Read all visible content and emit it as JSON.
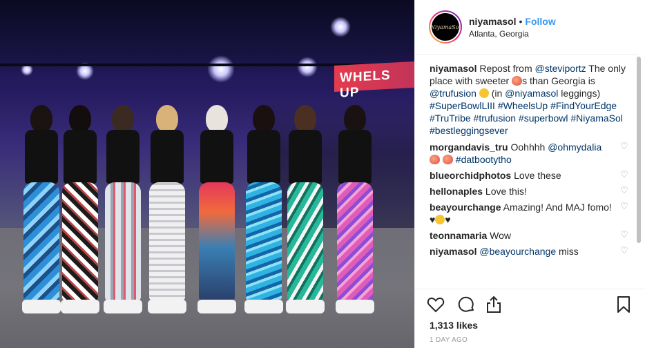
{
  "post": {
    "photo_sign_text": "WHELS UP",
    "header": {
      "avatar_text": "NiyamaSol",
      "username": "niyamasol",
      "separator": "•",
      "follow_label": "Follow",
      "location": "Atlanta, Georgia"
    },
    "caption": {
      "username": "niyamasol",
      "segments": {
        "t1": " Repost from ",
        "m1": "@steviportz",
        "t2": " The only place with sweeter ",
        "t3": "s than Georgia is ",
        "m2": "@trufusion",
        "t4": " (in ",
        "m3": "@niyamasol",
        "t5": " leggings)",
        "tags": "#SuperBowlLIII #WheelsUp #FindYourEdge #TruTribe #trufusion #superbowl #NiyamaSol #bestleggingsever"
      }
    },
    "comments": [
      {
        "username": "morgandavis_tru",
        "text": " Oohhhh ",
        "mention": "@ohmydalia",
        "tag": "#datbootytho"
      },
      {
        "username": "blueorchidphotos",
        "text": " Love these"
      },
      {
        "username": "hellonaples",
        "text": " Love this!"
      },
      {
        "username": "beayourchange",
        "text": " Amazing! And MAJ fomo! ♥",
        "text2": "♥"
      },
      {
        "username": "teonnamaria",
        "text": " Wow"
      },
      {
        "username": "niyamasol",
        "mention": "@beayourchange",
        "text": " miss"
      }
    ],
    "comment_heart": "♡",
    "likes": "1,313 likes",
    "timestamp": "1 DAY AGO",
    "icons": {
      "like": "heart-icon",
      "comment": "comment-icon",
      "share": "share-icon",
      "save": "bookmark-icon"
    },
    "colors": {
      "link": "#003569",
      "follow": "#3897f0",
      "muted": "#999999"
    }
  }
}
